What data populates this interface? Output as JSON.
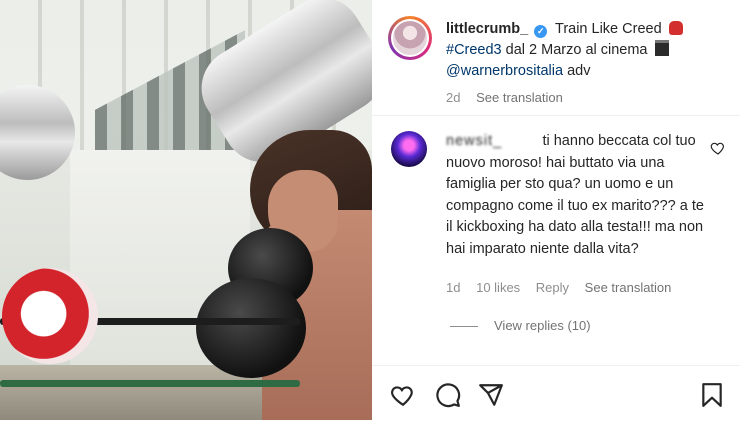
{
  "post": {
    "username": "littlecrumb_",
    "caption_line1": "Train Like Creed",
    "hashtag": "#Creed3",
    "caption_line2_rest": "dal 2 Marzo al cinema",
    "mention": "@warnerbrositalia",
    "caption_line3_rest": "adv",
    "age": "2d",
    "see_translation": "See translation"
  },
  "comment": {
    "name": "newsit_",
    "text_first": "ti hanno",
    "text_rest": "beccata col tuo nuovo moroso! hai buttato via una famiglia per sto qua? un uomo e un compagno come il tuo ex marito??? a te il kickboxing ha dato alla testa!!! ma non hai imparato niente dalla vita?",
    "age": "1d",
    "likes": "10 likes",
    "reply": "Reply",
    "see_translation": "See translation",
    "view_replies": "View replies (10)"
  },
  "icons": {
    "verified": "verified-badge-icon",
    "like": "heart-icon",
    "comment": "comment-icon",
    "share": "share-icon",
    "save": "bookmark-icon"
  },
  "colors": {
    "link": "#00376b",
    "verified": "#3897f0",
    "muted": "#8e8e8e"
  }
}
